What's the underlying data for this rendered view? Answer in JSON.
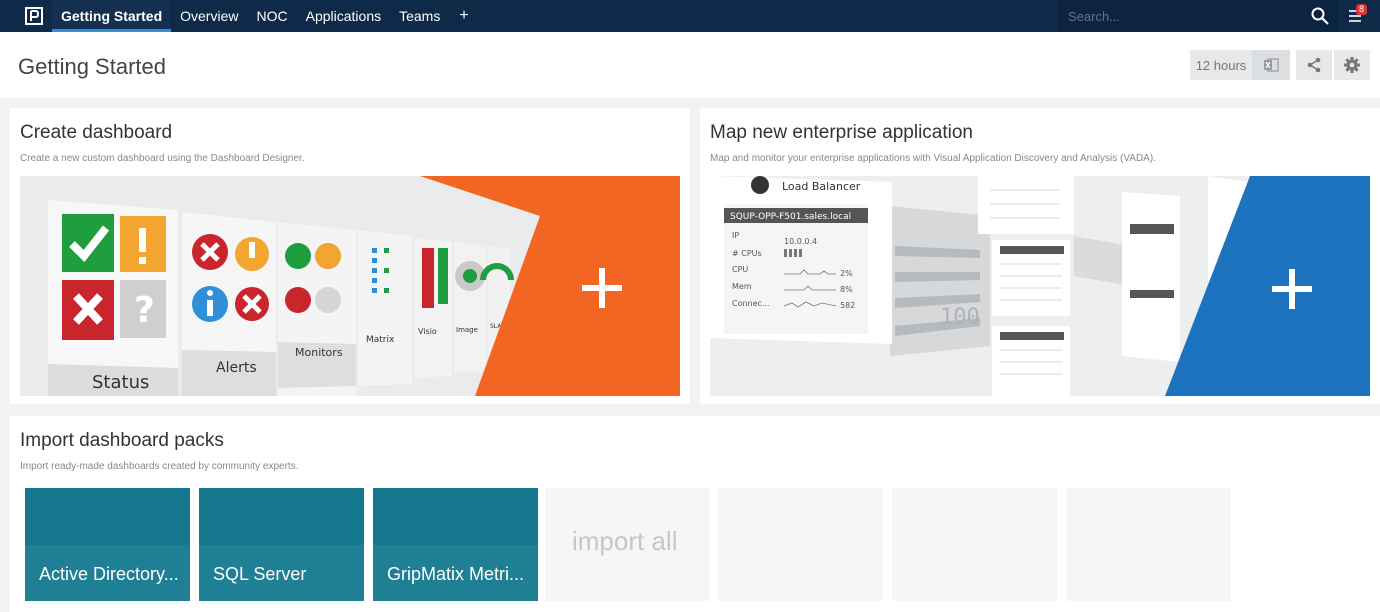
{
  "nav": {
    "items": [
      {
        "label": "Getting Started",
        "active": true
      },
      {
        "label": "Overview"
      },
      {
        "label": "NOC"
      },
      {
        "label": "Applications"
      },
      {
        "label": "Teams"
      }
    ],
    "add_label": "+",
    "search_placeholder": "Search...",
    "notification_count": "8"
  },
  "header": {
    "title": "Getting Started",
    "time_range": "12 hours"
  },
  "create_dashboard": {
    "title": "Create dashboard",
    "description": "Create a new custom dashboard using the Dashboard Designer.",
    "tiles": [
      "Status",
      "Alerts",
      "Monitors",
      "Matrix",
      "Visio",
      "Image",
      "SLA"
    ],
    "accent": "#f26522"
  },
  "map_app": {
    "title": "Map new enterprise application",
    "description": "Map and monitor your enterprise applications with Visual Application Discovery and Analysis (VADA).",
    "card_title": "Load Balancer",
    "server": "SQUP-OPP-F501.sales.local",
    "rows": [
      {
        "label": "IP",
        "value": "10.0.0.4"
      },
      {
        "label": "# CPUs",
        "value": ""
      },
      {
        "label": "CPU",
        "value": "2%"
      },
      {
        "label": "Mem",
        "value": "8%"
      },
      {
        "label": "Connec...",
        "value": "582"
      }
    ],
    "watermark": "100",
    "accent": "#1e73be"
  },
  "import_packs": {
    "title": "Import dashboard packs",
    "description": "Import ready-made dashboards created by community experts.",
    "packs": [
      "Active Directory...",
      "SQL Server",
      "GripMatix Metri..."
    ],
    "import_all_label": "import all"
  }
}
